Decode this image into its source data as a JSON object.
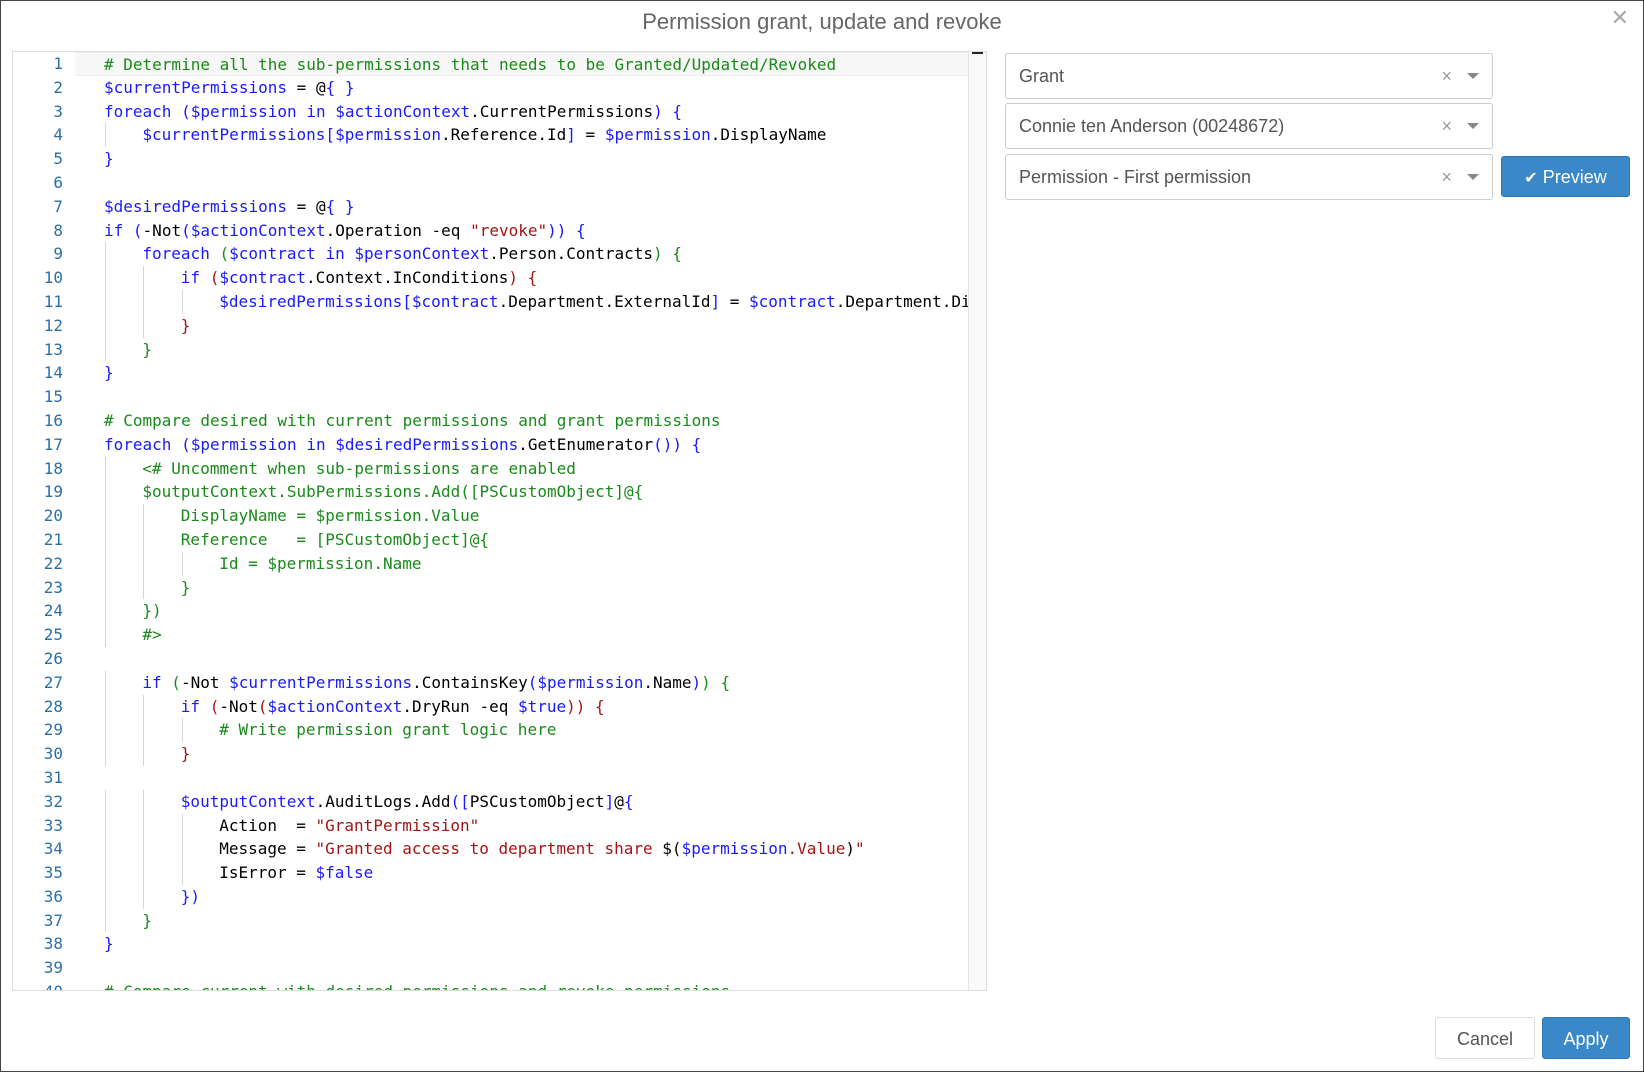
{
  "dialog": {
    "title": "Permission grant, update and revoke",
    "close_icon": "close-icon"
  },
  "selects": {
    "action": {
      "value": "Grant",
      "clear": "×"
    },
    "person": {
      "value": "Connie ten Anderson (00248672)",
      "clear": "×"
    },
    "permission": {
      "value": "Permission - First permission",
      "clear": "×"
    }
  },
  "buttons": {
    "preview_icon": "✔",
    "preview": "Preview",
    "cancel": "Cancel",
    "apply": "Apply"
  },
  "colors": {
    "primary": "#3a88c8",
    "comment": "#1a8a1a",
    "keyword": "#1a1aff",
    "string": "#a31515",
    "line_number": "#2b6fa8"
  },
  "editor": {
    "lines": [
      {
        "n": "1",
        "indent": 0,
        "tokens": [
          [
            "c",
            "# Determine all the sub-permissions that needs to be Granted/Updated/Revoked"
          ]
        ]
      },
      {
        "n": "2",
        "indent": 0,
        "tokens": [
          [
            "v",
            "$currentPermissions"
          ],
          [
            "p",
            " = "
          ],
          [
            "p",
            "@"
          ],
          [
            "b",
            "{ }"
          ]
        ]
      },
      {
        "n": "3",
        "indent": 0,
        "tokens": [
          [
            "k",
            "foreach"
          ],
          [
            "p",
            " "
          ],
          [
            "b",
            "("
          ],
          [
            "v",
            "$permission"
          ],
          [
            "p",
            " "
          ],
          [
            "k",
            "in"
          ],
          [
            "p",
            " "
          ],
          [
            "v",
            "$actionContext"
          ],
          [
            "p",
            ".CurrentPermissions"
          ],
          [
            "b",
            ")"
          ],
          [
            "p",
            " "
          ],
          [
            "b",
            "{"
          ]
        ]
      },
      {
        "n": "4",
        "indent": 1,
        "tokens": [
          [
            "v",
            "$currentPermissions"
          ],
          [
            "b",
            "["
          ],
          [
            "v",
            "$permission"
          ],
          [
            "p",
            ".Reference.Id"
          ],
          [
            "b",
            "]"
          ],
          [
            "p",
            " = "
          ],
          [
            "v",
            "$permission"
          ],
          [
            "p",
            ".DisplayName"
          ]
        ]
      },
      {
        "n": "5",
        "indent": 0,
        "tokens": [
          [
            "b",
            "}"
          ]
        ]
      },
      {
        "n": "6",
        "indent": 0,
        "tokens": []
      },
      {
        "n": "7",
        "indent": 0,
        "tokens": [
          [
            "v",
            "$desiredPermissions"
          ],
          [
            "p",
            " = "
          ],
          [
            "p",
            "@"
          ],
          [
            "b",
            "{ }"
          ]
        ]
      },
      {
        "n": "8",
        "indent": 0,
        "tokens": [
          [
            "k",
            "if"
          ],
          [
            "p",
            " "
          ],
          [
            "b",
            "("
          ],
          [
            "p",
            "-Not"
          ],
          [
            "b",
            "("
          ],
          [
            "v",
            "$actionContext"
          ],
          [
            "p",
            ".Operation -eq "
          ],
          [
            "s",
            "\"revoke\""
          ],
          [
            "b",
            "))"
          ],
          [
            "p",
            " "
          ],
          [
            "b",
            "{"
          ]
        ]
      },
      {
        "n": "9",
        "indent": 1,
        "tokens": [
          [
            "k",
            "foreach"
          ],
          [
            "p",
            " "
          ],
          [
            "n",
            "("
          ],
          [
            "v",
            "$contract"
          ],
          [
            "p",
            " "
          ],
          [
            "k",
            "in"
          ],
          [
            "p",
            " "
          ],
          [
            "v",
            "$personContext"
          ],
          [
            "p",
            ".Person.Contracts"
          ],
          [
            "n",
            ")"
          ],
          [
            "p",
            " "
          ],
          [
            "n",
            "{"
          ]
        ]
      },
      {
        "n": "10",
        "indent": 2,
        "tokens": [
          [
            "k",
            "if"
          ],
          [
            "p",
            " "
          ],
          [
            "s",
            "("
          ],
          [
            "v",
            "$contract"
          ],
          [
            "p",
            ".Context.InConditions"
          ],
          [
            "s",
            ")"
          ],
          [
            "p",
            " "
          ],
          [
            "s",
            "{"
          ]
        ]
      },
      {
        "n": "11",
        "indent": 3,
        "tokens": [
          [
            "v",
            "$desiredPermissions"
          ],
          [
            "b",
            "["
          ],
          [
            "v",
            "$contract"
          ],
          [
            "p",
            ".Department.ExternalId"
          ],
          [
            "b",
            "]"
          ],
          [
            "p",
            " = "
          ],
          [
            "v",
            "$contract"
          ],
          [
            "p",
            ".Department.DisplayName"
          ]
        ]
      },
      {
        "n": "12",
        "indent": 2,
        "tokens": [
          [
            "s",
            "}"
          ]
        ]
      },
      {
        "n": "13",
        "indent": 1,
        "tokens": [
          [
            "n",
            "}"
          ]
        ]
      },
      {
        "n": "14",
        "indent": 0,
        "tokens": [
          [
            "b",
            "}"
          ]
        ]
      },
      {
        "n": "15",
        "indent": 0,
        "tokens": []
      },
      {
        "n": "16",
        "indent": 0,
        "tokens": [
          [
            "c",
            "# Compare desired with current permissions and grant permissions"
          ]
        ]
      },
      {
        "n": "17",
        "indent": 0,
        "tokens": [
          [
            "k",
            "foreach"
          ],
          [
            "p",
            " "
          ],
          [
            "b",
            "("
          ],
          [
            "v",
            "$permission"
          ],
          [
            "p",
            " "
          ],
          [
            "k",
            "in"
          ],
          [
            "p",
            " "
          ],
          [
            "v",
            "$desiredPermissions"
          ],
          [
            "p",
            ".GetEnumerator"
          ],
          [
            "b",
            "())"
          ],
          [
            "p",
            " "
          ],
          [
            "b",
            "{"
          ]
        ]
      },
      {
        "n": "18",
        "indent": 1,
        "tokens": [
          [
            "c",
            "<# Uncomment when sub-permissions are enabled"
          ]
        ]
      },
      {
        "n": "19",
        "indent": 1,
        "tokens": [
          [
            "c",
            "$outputContext.SubPermissions.Add([PSCustomObject]@{"
          ]
        ]
      },
      {
        "n": "20",
        "indent": 2,
        "tokens": [
          [
            "c",
            "DisplayName = $permission.Value"
          ]
        ]
      },
      {
        "n": "21",
        "indent": 2,
        "tokens": [
          [
            "c",
            "Reference   = [PSCustomObject]@{"
          ]
        ]
      },
      {
        "n": "22",
        "indent": 3,
        "tokens": [
          [
            "c",
            "Id = $permission.Name"
          ]
        ]
      },
      {
        "n": "23",
        "indent": 2,
        "tokens": [
          [
            "c",
            "}"
          ]
        ]
      },
      {
        "n": "24",
        "indent": 1,
        "tokens": [
          [
            "c",
            "})"
          ]
        ]
      },
      {
        "n": "25",
        "indent": 1,
        "tokens": [
          [
            "c",
            "#>"
          ]
        ]
      },
      {
        "n": "26",
        "indent": 0,
        "tokens": []
      },
      {
        "n": "27",
        "indent": 1,
        "tokens": [
          [
            "k",
            "if"
          ],
          [
            "p",
            " "
          ],
          [
            "n",
            "("
          ],
          [
            "p",
            "-Not "
          ],
          [
            "v",
            "$currentPermissions"
          ],
          [
            "p",
            ".ContainsKey"
          ],
          [
            "b",
            "("
          ],
          [
            "v",
            "$permission"
          ],
          [
            "p",
            ".Name"
          ],
          [
            "b",
            ")"
          ],
          [
            "n",
            ")"
          ],
          [
            "p",
            " "
          ],
          [
            "n",
            "{"
          ]
        ]
      },
      {
        "n": "28",
        "indent": 2,
        "tokens": [
          [
            "k",
            "if"
          ],
          [
            "p",
            " "
          ],
          [
            "s",
            "("
          ],
          [
            "p",
            "-Not"
          ],
          [
            "s",
            "("
          ],
          [
            "v",
            "$actionContext"
          ],
          [
            "p",
            ".DryRun -eq "
          ],
          [
            "v",
            "$true"
          ],
          [
            "s",
            "))"
          ],
          [
            "p",
            " "
          ],
          [
            "s",
            "{"
          ]
        ]
      },
      {
        "n": "29",
        "indent": 3,
        "tokens": [
          [
            "c",
            "# Write permission grant logic here"
          ]
        ]
      },
      {
        "n": "30",
        "indent": 2,
        "tokens": [
          [
            "s",
            "}"
          ]
        ]
      },
      {
        "n": "31",
        "indent": 0,
        "tokens": []
      },
      {
        "n": "32",
        "indent": 2,
        "tokens": [
          [
            "v",
            "$outputContext"
          ],
          [
            "p",
            ".AuditLogs.Add"
          ],
          [
            "b",
            "(["
          ],
          [
            "p",
            "PSCustomObject"
          ],
          [
            "b",
            "]"
          ],
          [
            "p",
            "@"
          ],
          [
            "b",
            "{"
          ]
        ]
      },
      {
        "n": "33",
        "indent": 3,
        "tokens": [
          [
            "p",
            "Action  = "
          ],
          [
            "s",
            "\"GrantPermission\""
          ]
        ]
      },
      {
        "n": "34",
        "indent": 3,
        "tokens": [
          [
            "p",
            "Message = "
          ],
          [
            "s",
            "\"Granted access to department share "
          ],
          [
            "p",
            "$("
          ],
          [
            "v",
            "$permission"
          ],
          [
            "s",
            ".Value"
          ],
          [
            "p",
            ")"
          ],
          [
            "s",
            "\""
          ]
        ]
      },
      {
        "n": "35",
        "indent": 3,
        "tokens": [
          [
            "p",
            "IsError = "
          ],
          [
            "v",
            "$false"
          ]
        ]
      },
      {
        "n": "36",
        "indent": 2,
        "tokens": [
          [
            "b",
            "})"
          ]
        ]
      },
      {
        "n": "37",
        "indent": 1,
        "tokens": [
          [
            "n",
            "}"
          ]
        ]
      },
      {
        "n": "38",
        "indent": 0,
        "tokens": [
          [
            "b",
            "}"
          ]
        ]
      },
      {
        "n": "39",
        "indent": 0,
        "tokens": []
      },
      {
        "n": "40",
        "indent": 0,
        "tokens": [
          [
            "c",
            "# Compare current with desired permissions and revoke permissions"
          ]
        ]
      }
    ]
  }
}
